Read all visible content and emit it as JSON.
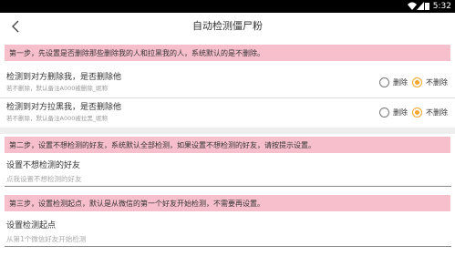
{
  "status_bar": {
    "time": "5:32"
  },
  "app_bar": {
    "title": "自动检测僵尸粉"
  },
  "step1": {
    "banner": "第一步，先设置是否删除那些删除我的人和拉黑我的人，系统默认的是不删除。",
    "rows": [
      {
        "main": "检测到对方删除我，是否删除他",
        "sub": "若不删除，默认备注A000被删除_昵称",
        "option_delete": "删除",
        "option_keep": "不删除",
        "selected": "不删除"
      },
      {
        "main": "检测到对方拉黑我，是否删除他",
        "sub": "若不删除，默认备注A000被拉黑_昵称",
        "option_delete": "删除",
        "option_keep": "不删除",
        "selected": "不删除"
      }
    ]
  },
  "step2": {
    "banner": "第二步，设置不想检测的好友，系统默认全部检测，如果设置不想检测的好友，请按提示设置。",
    "label": "设置不想检测的好友",
    "placeholder": "点我设置不想检测的好友"
  },
  "step3": {
    "banner": "第三步，设置检测起点，默认是从微信的第一个好友开始检测，不需要再设置。",
    "label": "设置检测起点",
    "placeholder": "从第1个微信好友开始检测"
  },
  "colors": {
    "banner_bg": "#f7bfcc",
    "radio_accent": "#f2a62c"
  },
  "icons": {
    "back": "back-arrow-icon",
    "wifi": "wifi-icon",
    "signal": "signal-icon",
    "battery": "battery-icon"
  }
}
